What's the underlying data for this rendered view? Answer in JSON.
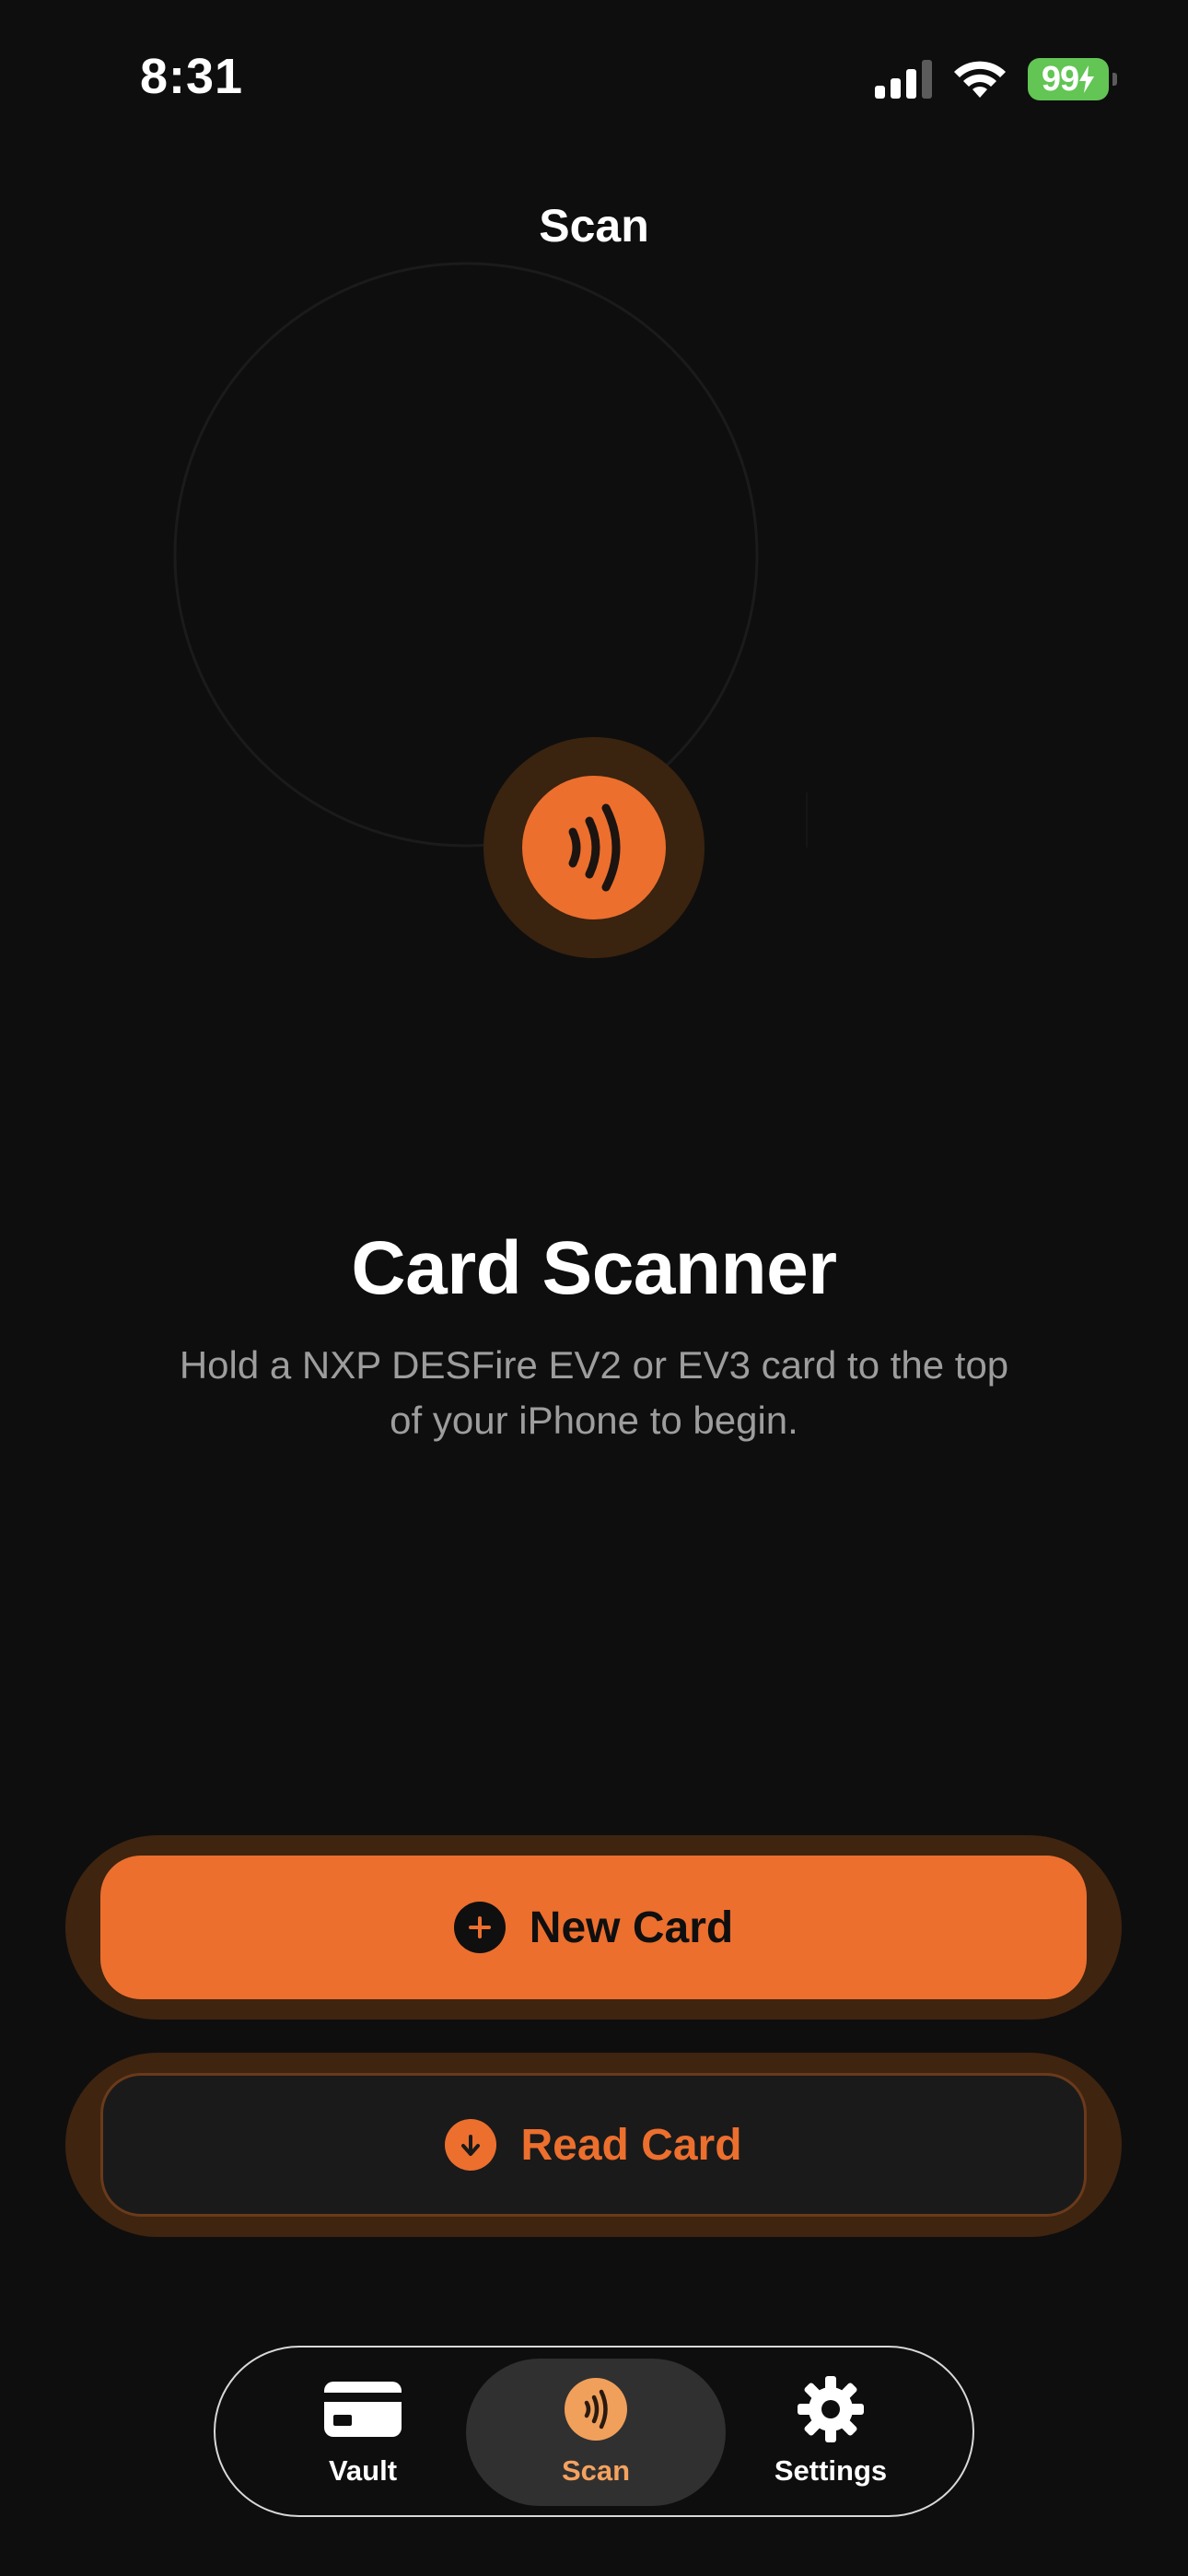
{
  "status_bar": {
    "time": "8:31",
    "battery_level": "99"
  },
  "nav": {
    "title": "Scan"
  },
  "hero": {
    "title": "Card Scanner",
    "subtitle": "Hold a NXP DESFire EV2 or EV3 card to the top of your iPhone to begin."
  },
  "actions": {
    "new_card_label": "New Card",
    "read_card_label": "Read Card"
  },
  "tab_bar": {
    "items": [
      {
        "label": "Vault",
        "icon": "card-icon"
      },
      {
        "label": "Scan",
        "icon": "nfc-icon",
        "selected": true
      },
      {
        "label": "Settings",
        "icon": "gear-icon"
      }
    ]
  },
  "colors": {
    "background": "#0e0e0e",
    "accent": "#ec6f2e",
    "accent_dark": "#3f2410",
    "subtitle_gray": "#9d9d9d",
    "battery_green": "#62c554"
  }
}
